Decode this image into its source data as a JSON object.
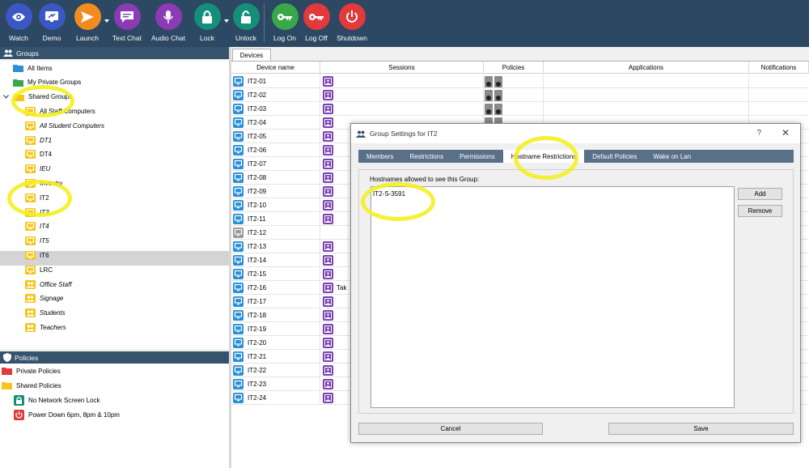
{
  "toolbar": {
    "buttons": [
      {
        "label": "Watch",
        "icon": "eye-icon",
        "color": "#3b57c4"
      },
      {
        "label": "Demo",
        "icon": "demo-screen-icon",
        "color": "#3b57c4"
      },
      {
        "label": "Launch",
        "icon": "send-icon",
        "color": "#f28c1e"
      },
      {
        "label": "Text Chat",
        "icon": "chat-icon",
        "color": "#8b3bb4"
      },
      {
        "label": "Audio Chat",
        "icon": "microphone-icon",
        "color": "#8b3bb4"
      },
      {
        "label": "Lock",
        "icon": "lock-icon",
        "color": "#14907a"
      },
      {
        "label": "Unlock",
        "icon": "unlock-icon",
        "color": "#14907a"
      },
      {
        "label": "Log On",
        "icon": "key-icon",
        "color": "#3aa84a"
      },
      {
        "label": "Log Off",
        "icon": "key-icon",
        "color": "#e03a3a"
      },
      {
        "label": "Shutdown",
        "icon": "power-icon",
        "color": "#e03a3a"
      }
    ]
  },
  "groups": {
    "title": "Groups",
    "items": [
      {
        "label": "All Items",
        "italic": false
      },
      {
        "label": "My Private Groups",
        "italic": false
      },
      {
        "label": "Shared Groups",
        "italic": false
      },
      {
        "label": "All Staff Computers",
        "italic": false
      },
      {
        "label": "All Student Computers",
        "italic": true
      },
      {
        "label": "DT1",
        "italic": true
      },
      {
        "label": "DT4",
        "italic": false
      },
      {
        "label": "IEU",
        "italic": true
      },
      {
        "label": "Inventry",
        "italic": false
      },
      {
        "label": "IT2",
        "italic": false
      },
      {
        "label": "IT3",
        "italic": true
      },
      {
        "label": "IT4",
        "italic": true
      },
      {
        "label": "IT5",
        "italic": true
      },
      {
        "label": "IT6",
        "italic": false
      },
      {
        "label": "LRC",
        "italic": false
      },
      {
        "label": "Office Staff",
        "italic": true
      },
      {
        "label": "Signage",
        "italic": true
      },
      {
        "label": "Students",
        "italic": true
      },
      {
        "label": "Teachers",
        "italic": true
      }
    ]
  },
  "policies": {
    "title": "Policies",
    "items": [
      {
        "label": "Private Policies"
      },
      {
        "label": "Shared Policies"
      },
      {
        "label": "No Network Screen Lock"
      },
      {
        "label": "Power Down 6pm, 8pm & 10pm"
      }
    ]
  },
  "devices": {
    "tab": "Devices",
    "columns": [
      "Device name",
      "Sessions",
      "Policies",
      "Applications",
      "Notifications"
    ],
    "rows": [
      {
        "name": "IT2-01",
        "session": true,
        "policies": true,
        "session_text": ""
      },
      {
        "name": "IT2-02",
        "session": true,
        "policies": true,
        "session_text": ""
      },
      {
        "name": "IT2-03",
        "session": true,
        "policies": true,
        "session_text": ""
      },
      {
        "name": "IT2-04",
        "session": true,
        "policies": true,
        "session_text": ""
      },
      {
        "name": "IT2-05",
        "session": true,
        "policies": false,
        "session_text": ""
      },
      {
        "name": "IT2-06",
        "session": true,
        "policies": false,
        "session_text": ""
      },
      {
        "name": "IT2-07",
        "session": true,
        "policies": false,
        "session_text": ""
      },
      {
        "name": "IT2-08",
        "session": true,
        "policies": false,
        "session_text": ""
      },
      {
        "name": "IT2-09",
        "session": true,
        "policies": false,
        "session_text": ""
      },
      {
        "name": "IT2-10",
        "session": true,
        "policies": false,
        "session_text": ""
      },
      {
        "name": "IT2-11",
        "session": true,
        "policies": false,
        "session_text": ""
      },
      {
        "name": "IT2-12",
        "session": false,
        "policies": false,
        "session_text": "",
        "offline": true
      },
      {
        "name": "IT2-13",
        "session": true,
        "policies": false,
        "session_text": ""
      },
      {
        "name": "IT2-14",
        "session": true,
        "policies": false,
        "session_text": ""
      },
      {
        "name": "IT2-15",
        "session": true,
        "policies": false,
        "session_text": ""
      },
      {
        "name": "IT2-16",
        "session": true,
        "policies": false,
        "session_text": "Tak"
      },
      {
        "name": "IT2-17",
        "session": true,
        "policies": false,
        "session_text": ""
      },
      {
        "name": "IT2-18",
        "session": true,
        "policies": false,
        "session_text": ""
      },
      {
        "name": "IT2-19",
        "session": true,
        "policies": false,
        "session_text": ""
      },
      {
        "name": "IT2-20",
        "session": true,
        "policies": false,
        "session_text": ""
      },
      {
        "name": "IT2-21",
        "session": true,
        "policies": false,
        "session_text": ""
      },
      {
        "name": "IT2-22",
        "session": true,
        "policies": false,
        "session_text": ""
      },
      {
        "name": "IT2-23",
        "session": true,
        "policies": false,
        "session_text": ""
      },
      {
        "name": "IT2-24",
        "session": true,
        "policies": false,
        "session_text": ""
      }
    ]
  },
  "dialog": {
    "title": "Group Settings for IT2",
    "help": "?",
    "close": "✕",
    "tabs": [
      "Members",
      "Restrictions",
      "Permissions",
      "Hostname Restrictions",
      "Default Policies",
      "Wake on Lan"
    ],
    "active_tab": 3,
    "list_label": "Hostnames allowed to see this Group:",
    "hostnames": [
      "IT2-S-3591"
    ],
    "add_label": "Add",
    "remove_label": "Remove",
    "cancel_label": "Cancel",
    "save_label": "Save"
  },
  "colors": {
    "toolbar_bg": "#2c4862",
    "panel_header": "#35536d",
    "folder_yellow": "#f5c518",
    "monitor_blue": "#2b8fd8",
    "session_purple": "#7a3fb0",
    "highlight_yellow": "#f4ef1a"
  }
}
